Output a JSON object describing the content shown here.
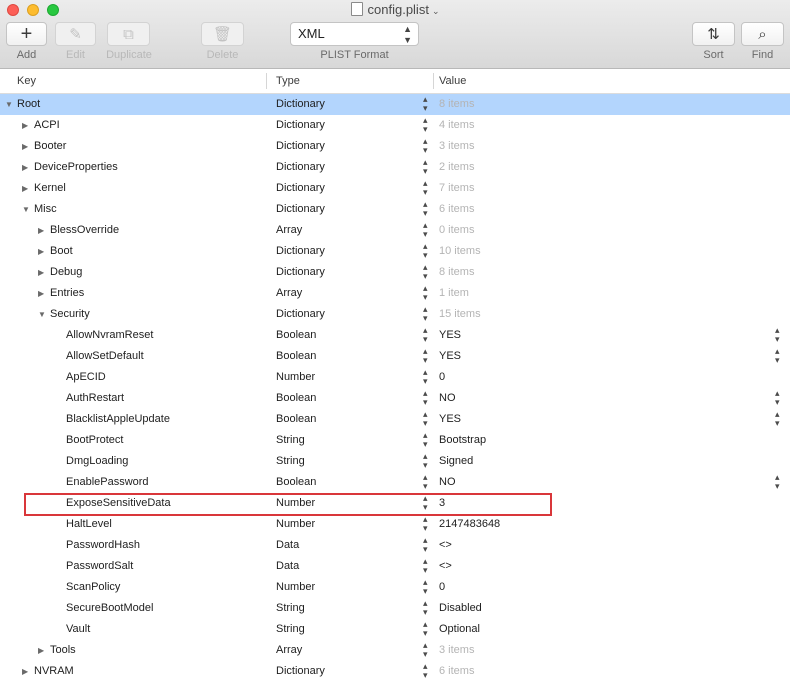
{
  "window": {
    "title": "config.plist"
  },
  "toolbar": {
    "add_label": "Add",
    "edit_label": "Edit",
    "duplicate_label": "Duplicate",
    "delete_label": "Delete",
    "format_value": "XML",
    "format_label": "PLIST Format",
    "sort_label": "Sort",
    "find_label": "Find"
  },
  "columns": {
    "key": "Key",
    "type": "Type",
    "value": "Value"
  },
  "rows": [
    {
      "key": "Root",
      "type": "Dictionary",
      "value": "8 items"
    },
    {
      "key": "ACPI",
      "type": "Dictionary",
      "value": "4 items"
    },
    {
      "key": "Booter",
      "type": "Dictionary",
      "value": "3 items"
    },
    {
      "key": "DeviceProperties",
      "type": "Dictionary",
      "value": "2 items"
    },
    {
      "key": "Kernel",
      "type": "Dictionary",
      "value": "7 items"
    },
    {
      "key": "Misc",
      "type": "Dictionary",
      "value": "6 items"
    },
    {
      "key": "BlessOverride",
      "type": "Array",
      "value": "0 items"
    },
    {
      "key": "Boot",
      "type": "Dictionary",
      "value": "10 items"
    },
    {
      "key": "Debug",
      "type": "Dictionary",
      "value": "8 items"
    },
    {
      "key": "Entries",
      "type": "Array",
      "value": "1 item"
    },
    {
      "key": "Security",
      "type": "Dictionary",
      "value": "15 items"
    },
    {
      "key": "AllowNvramReset",
      "type": "Boolean",
      "value": "YES"
    },
    {
      "key": "AllowSetDefault",
      "type": "Boolean",
      "value": "YES"
    },
    {
      "key": "ApECID",
      "type": "Number",
      "value": "0"
    },
    {
      "key": "AuthRestart",
      "type": "Boolean",
      "value": "NO"
    },
    {
      "key": "BlacklistAppleUpdate",
      "type": "Boolean",
      "value": "YES"
    },
    {
      "key": "BootProtect",
      "type": "String",
      "value": "Bootstrap"
    },
    {
      "key": "DmgLoading",
      "type": "String",
      "value": "Signed"
    },
    {
      "key": "EnablePassword",
      "type": "Boolean",
      "value": "NO"
    },
    {
      "key": "ExposeSensitiveData",
      "type": "Number",
      "value": "3"
    },
    {
      "key": "HaltLevel",
      "type": "Number",
      "value": "2147483648"
    },
    {
      "key": "PasswordHash",
      "type": "Data",
      "value": "<>"
    },
    {
      "key": "PasswordSalt",
      "type": "Data",
      "value": "<>"
    },
    {
      "key": "ScanPolicy",
      "type": "Number",
      "value": "0"
    },
    {
      "key": "SecureBootModel",
      "type": "String",
      "value": "Disabled"
    },
    {
      "key": "Vault",
      "type": "String",
      "value": "Optional"
    },
    {
      "key": "Tools",
      "type": "Array",
      "value": "3 items"
    },
    {
      "key": "NVRAM",
      "type": "Dictionary",
      "value": "6 items"
    }
  ],
  "colors": {
    "selection": "#b3d5fd",
    "highlight_box": "#d9363a"
  }
}
